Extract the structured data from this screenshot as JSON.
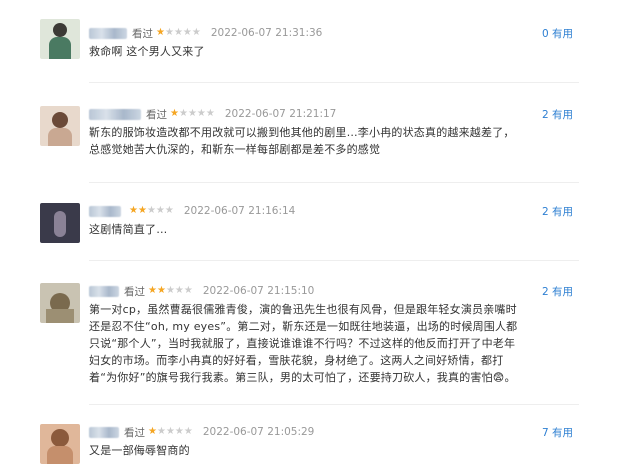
{
  "reviews": [
    {
      "action": "看过",
      "rating": 1,
      "time": "2022-06-07 21:31:36",
      "useful": "0 有用",
      "content": "救命啊 这个男人又来了"
    },
    {
      "action": "看过",
      "rating": 1,
      "time": "2022-06-07 21:21:17",
      "useful": "2 有用",
      "content": "靳东的服饰妆造改都不用改就可以搬到他其他的剧里…李小冉的状态真的越来越差了，总感觉她苦大仇深的，和靳东一样每部剧都是差不多的感觉"
    },
    {
      "action": "",
      "rating": 2,
      "time": "2022-06-07 21:16:14",
      "useful": "2 有用",
      "content": "这剧情简直了…"
    },
    {
      "action": "看过",
      "rating": 2,
      "time": "2022-06-07 21:15:10",
      "useful": "2 有用",
      "content": "第一对cp，虽然曹磊很儒雅青俊，演的鲁迅先生也很有风骨，但是跟年轻女演员亲嘴时还是忍不住“oh, my eyes”。第二对，靳东还是一如既往地装逼，出场的时候周围人都只说“那个人”，当时我就服了，直接说谁谁谁不行吗？不过这样的他反而打开了中老年妇女的市场。而李小冉真的好好看，雪肤花貌，身材绝了。这两人之间好矫情，都打着“为你好”的旗号我行我素。第三队，男的太可怕了，还要持刀砍人，我真的害怕😨。"
    },
    {
      "action": "看过",
      "rating": 1,
      "time": "2022-06-07 21:05:29",
      "useful": "7 有用",
      "content": "又是一部侮辱智商的"
    }
  ],
  "colors": {
    "star_on": "#f5a623",
    "star_off": "#cccccc",
    "useful_link": "#2d7fd2",
    "time": "#999999"
  }
}
